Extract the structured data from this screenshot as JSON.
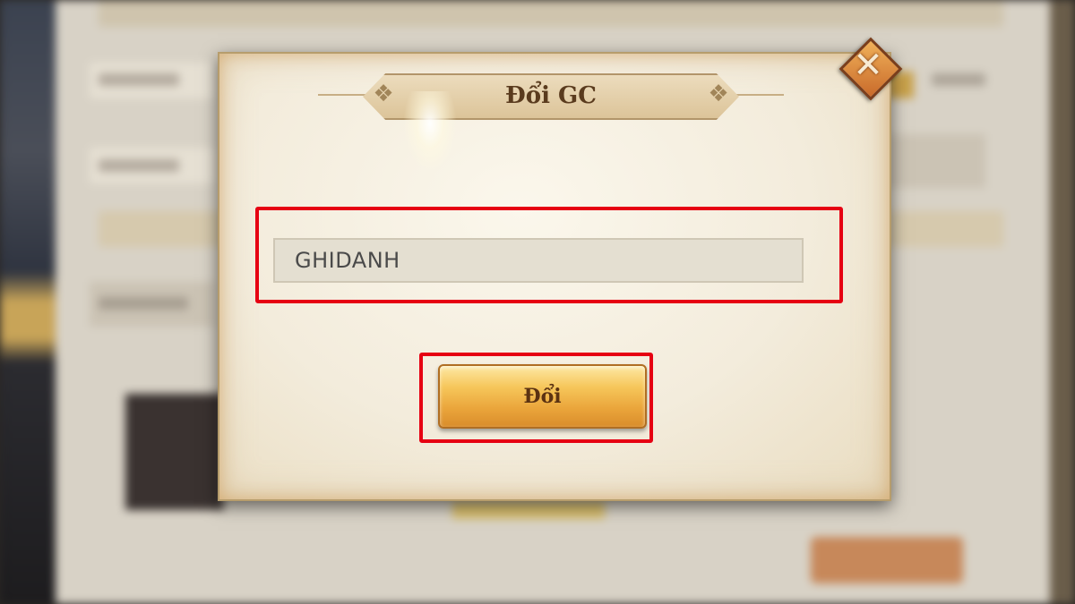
{
  "dialog": {
    "title": "Đổi GC",
    "input_value": "GHIDANH",
    "button_label": "Đổi"
  },
  "icons": {
    "close": "close-icon",
    "title_ornament": "ornament-icon"
  },
  "colors": {
    "highlight": "#e60012",
    "button_gold": "#f6c65a",
    "title_text": "#5a3b1e",
    "dialog_bg": "#f3ecdc"
  }
}
